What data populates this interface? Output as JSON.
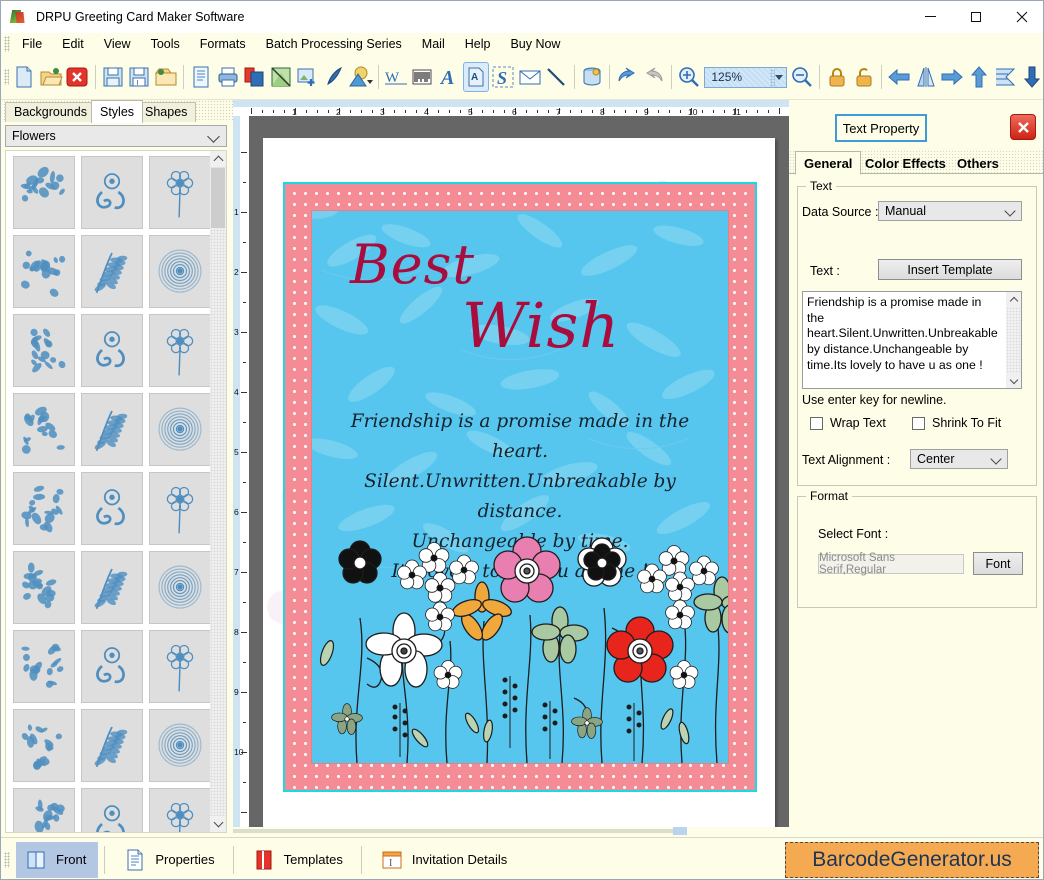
{
  "window": {
    "title": "DRPU Greeting Card Maker Software",
    "app_icon": "app-icon",
    "minimize": "—",
    "maximize": "□",
    "close": "✕"
  },
  "menubar": {
    "items": [
      "File",
      "Edit",
      "View",
      "Tools",
      "Formats",
      "Batch Processing Series",
      "Mail",
      "Help",
      "Buy Now"
    ]
  },
  "toolbar": {
    "zoom_value": "125%",
    "icons": [
      "new-document-icon",
      "open-folder-icon",
      "close-document-icon",
      "save-icon",
      "save-as-icon",
      "export-icon",
      "page-setup-icon",
      "print-icon",
      "card-layers-icon",
      "background-icon",
      "insert-image-icon",
      "pen-icon",
      "shape-gallery-icon",
      "watermark-icon",
      "barcode-icon",
      "text-icon",
      "text-box-icon",
      "signature-icon",
      "envelope-icon",
      "line-icon",
      "database-icon",
      "undo-icon",
      "redo-icon",
      "zoom-in-icon",
      "zoom-out-icon",
      "lock-icon",
      "unlock-icon",
      "align-left-icon",
      "flip-horizontal-icon",
      "align-right-icon",
      "align-top-icon",
      "distribute-icon",
      "align-bottom-icon"
    ]
  },
  "left_panel": {
    "tabs": [
      {
        "label": "Backgrounds",
        "selected": false
      },
      {
        "label": "Styles",
        "selected": true
      },
      {
        "label": "Shapes",
        "selected": false
      }
    ],
    "category": "Flowers",
    "category_icon": "chevron-down-icon",
    "scroll_up_icon": "scroll-up-icon",
    "scroll_down_icon": "scroll-down-icon",
    "thumbnail_count": 27
  },
  "canvas": {
    "h_ruler_ticks": [
      "1",
      "2",
      "3",
      "4",
      "5",
      "6",
      "7",
      "8",
      "9",
      "10",
      "11"
    ],
    "v_ruler_ticks": [
      "1",
      "2",
      "3",
      "4",
      "5",
      "6",
      "7",
      "8",
      "9",
      "10"
    ],
    "card": {
      "heading_line1": "Best",
      "heading_line2": "Wish",
      "quote_lines": [
        "Friendship is a promise made in the heart.",
        "Silent.Unwritten.Unbreakable by distance.",
        "Unchangeable by time.",
        "Its lovely to have u as one !"
      ],
      "colors": {
        "border_dots": "#f58b94",
        "inner_bg": "#57c6ef",
        "heading": "#a80d3e",
        "selection": "#19d8e8"
      }
    }
  },
  "right_panel": {
    "title": "Text Property",
    "close_icon": "close-icon",
    "tabs": [
      {
        "label": "General",
        "selected": true
      },
      {
        "label": "Color Effects",
        "selected": false
      },
      {
        "label": "Others",
        "selected": false
      }
    ],
    "text_group": {
      "legend": "Text",
      "data_source_label": "Data Source :",
      "data_source_value": "Manual",
      "text_label": "Text :",
      "insert_template_label": "Insert Template",
      "textarea_value": "Friendship is a promise made in the heart.Silent.Unwritten.Unbreakable by distance.Unchangeable by time.Its lovely to have u as one !",
      "hint": "Use enter key for newline.",
      "wrap_text_label": "Wrap Text",
      "wrap_text_checked": false,
      "shrink_to_fit_label": "Shrink To Fit",
      "shrink_to_fit_checked": false,
      "alignment_label": "Text Alignment :",
      "alignment_value": "Center"
    },
    "format_group": {
      "legend": "Format",
      "select_font_label": "Select Font :",
      "font_value": "Microsoft Sans Serif,Regular",
      "font_button_label": "Font"
    }
  },
  "bottom_bar": {
    "buttons": [
      {
        "label": "Front",
        "icon": "front-card-icon",
        "selected": true
      },
      {
        "label": "Properties",
        "icon": "properties-icon",
        "selected": false
      },
      {
        "label": "Templates",
        "icon": "templates-icon",
        "selected": false
      },
      {
        "label": "Invitation Details",
        "icon": "invitation-details-icon",
        "selected": false
      }
    ],
    "brand": "BarcodeGenerator.us",
    "brand_color": "#f5aa52"
  }
}
